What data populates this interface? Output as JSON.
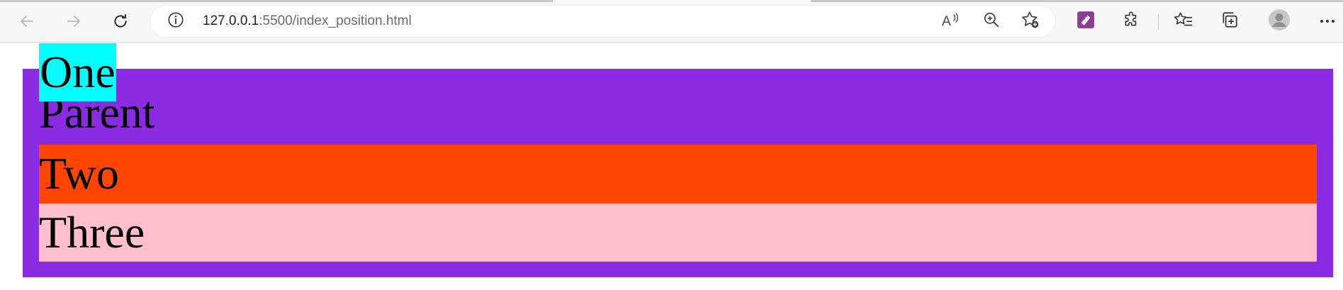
{
  "browser": {
    "address_bar": {
      "url_host": "127.0.0.1",
      "url_rest": ":5500/index_position.html"
    },
    "icons": {
      "back": "back-arrow-icon",
      "forward": "forward-arrow-icon",
      "refresh": "refresh-icon",
      "site_info": "info-icon",
      "read_aloud": "read-aloud-icon",
      "zoom": "zoom-in-icon",
      "add_favorite": "add-favorite-icon",
      "extension": "extension-app-icon",
      "extensions": "puzzle-piece-icon",
      "favorites": "favorites-icon",
      "collections": "collections-icon",
      "profile": "profile-avatar-icon",
      "menu": "more-menu-icon"
    }
  },
  "page": {
    "parent": {
      "label": "Parent",
      "color": "#8a2be2"
    },
    "one": {
      "label": "One",
      "color": "#00ffff"
    },
    "two": {
      "label": "Two",
      "color": "#ff4500"
    },
    "three": {
      "label": "Three",
      "color": "#ffc0cb"
    }
  }
}
